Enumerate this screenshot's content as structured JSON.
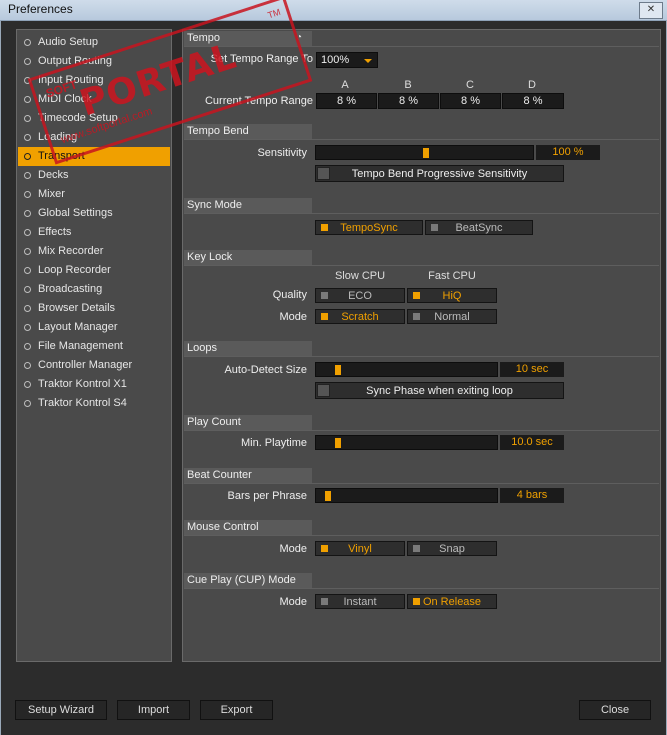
{
  "window": {
    "title": "Preferences",
    "close_glyph": "✕"
  },
  "watermark": {
    "brand": "PORTAL",
    "prefix": "SOFT",
    "url": "www.softportal.com",
    "tm": "TM"
  },
  "sidebar": {
    "items": [
      {
        "label": "Audio Setup"
      },
      {
        "label": "Output Routing"
      },
      {
        "label": "Input Routing"
      },
      {
        "label": "MIDI Clock"
      },
      {
        "label": "Timecode Setup"
      },
      {
        "label": "Loading"
      },
      {
        "label": "Transport"
      },
      {
        "label": "Decks"
      },
      {
        "label": "Mixer"
      },
      {
        "label": "Global Settings"
      },
      {
        "label": "Effects"
      },
      {
        "label": "Mix Recorder"
      },
      {
        "label": "Loop Recorder"
      },
      {
        "label": "Broadcasting"
      },
      {
        "label": "Browser Details"
      },
      {
        "label": "Layout Manager"
      },
      {
        "label": "File Management"
      },
      {
        "label": "Controller Manager"
      },
      {
        "label": "Traktor Kontrol X1"
      },
      {
        "label": "Traktor Kontrol S4"
      }
    ],
    "active_index": 6
  },
  "tempo": {
    "header": "Tempo",
    "set_range_label": "Set Tempo Range To",
    "set_range_value": "100%",
    "current_range_label": "Current Tempo Range",
    "columns": [
      "A",
      "B",
      "C",
      "D"
    ],
    "values": [
      "8 %",
      "8 %",
      "8 %",
      "8 %"
    ]
  },
  "tempo_bend": {
    "header": "Tempo Bend",
    "sensitivity_label": "Sensitivity",
    "sensitivity_value": "100 %",
    "sensitivity_level": 0.5,
    "progressive_label": "Tempo Bend Progressive Sensitivity"
  },
  "sync_mode": {
    "header": "Sync Mode",
    "options": [
      "TempoSync",
      "BeatSync"
    ],
    "selected": 0
  },
  "key_lock": {
    "header": "Key Lock",
    "slow_cpu": "Slow CPU",
    "fast_cpu": "Fast CPU",
    "quality_label": "Quality",
    "quality_options": [
      "ECO",
      "HiQ"
    ],
    "mode_label": "Mode",
    "mode_options": [
      "Scratch",
      "Normal"
    ]
  },
  "loops": {
    "header": "Loops",
    "auto_detect_label": "Auto-Detect Size",
    "auto_detect_value": "10 sec",
    "auto_detect_level": 0.1,
    "sync_phase_label": "Sync Phase when exiting loop"
  },
  "play_count": {
    "header": "Play Count",
    "min_playtime_label": "Min. Playtime",
    "min_playtime_value": "10.0 sec",
    "min_playtime_level": 0.1
  },
  "beat_counter": {
    "header": "Beat Counter",
    "bars_label": "Bars per Phrase",
    "bars_value": "4 bars",
    "bars_level": 0.04
  },
  "mouse_control": {
    "header": "Mouse Control",
    "mode_label": "Mode",
    "options": [
      "Vinyl",
      "Snap"
    ]
  },
  "cue_play": {
    "header": "Cue Play (CUP) Mode",
    "mode_label": "Mode",
    "options": [
      "Instant",
      "On Release"
    ]
  },
  "footer": {
    "setup_wizard": "Setup Wizard",
    "import": "Import",
    "export": "Export",
    "close": "Close"
  },
  "colors": {
    "accent": "#f0a000",
    "panel": "#4a4a4a",
    "field": "#1b1b1b"
  }
}
